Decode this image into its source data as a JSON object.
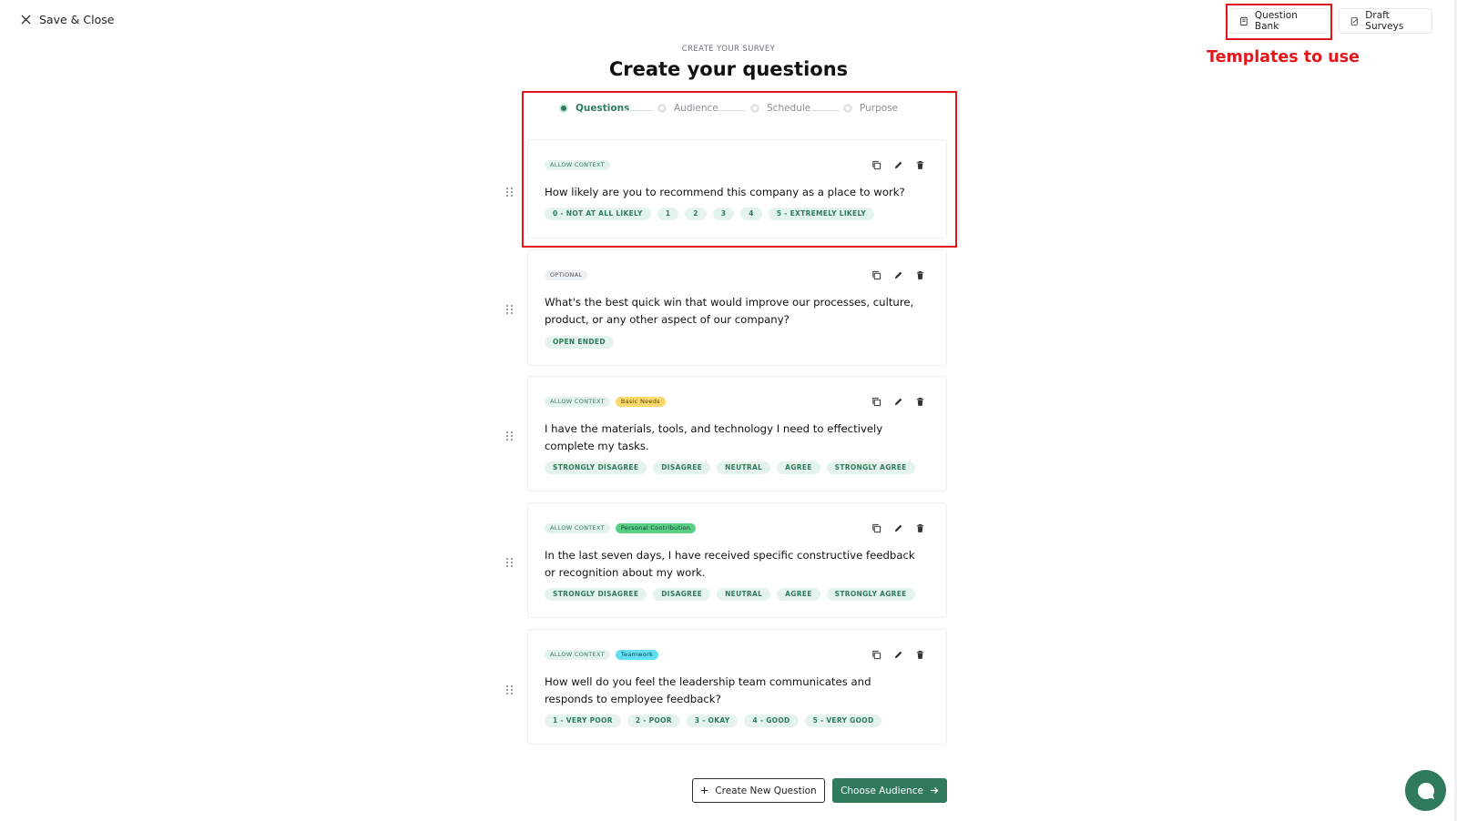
{
  "header": {
    "save_close_label": "Save & Close",
    "question_bank_label": "Question Bank",
    "draft_surveys_label": "Draft Surveys"
  },
  "annotation": {
    "text": "Templates to use",
    "color": "#e3161b"
  },
  "page": {
    "eyebrow": "CREATE YOUR SURVEY",
    "title": "Create your questions"
  },
  "stepper": {
    "steps": [
      {
        "label": "Questions",
        "active": true
      },
      {
        "label": "Audience",
        "active": false
      },
      {
        "label": "Schedule",
        "active": false
      },
      {
        "label": "Purpose",
        "active": false
      }
    ]
  },
  "questions": [
    {
      "tags": [
        "ALLOW CONTEXT"
      ],
      "category": "",
      "text": "How likely are you to recommend this company as a place to work?",
      "options": [
        "0 - NOT AT ALL LIKELY",
        "1",
        "2",
        "3",
        "4",
        "5 - EXTREMELY LIKELY"
      ]
    },
    {
      "tags": [
        "OPTIONAL"
      ],
      "category": "",
      "text": "What's the best quick win that would improve our processes, culture, product, or any other aspect of our company?",
      "options": [
        "OPEN ENDED"
      ]
    },
    {
      "tags": [
        "ALLOW CONTEXT"
      ],
      "category": "Basic Needs",
      "text": "I have the materials, tools, and technology I need to effectively complete my tasks.",
      "options": [
        "STRONGLY DISAGREE",
        "DISAGREE",
        "NEUTRAL",
        "AGREE",
        "STRONGLY AGREE"
      ]
    },
    {
      "tags": [
        "ALLOW CONTEXT"
      ],
      "category": "Personal Contribution",
      "text": "In the last seven days, I have received specific constructive feedback or recognition about my work.",
      "options": [
        "STRONGLY DISAGREE",
        "DISAGREE",
        "NEUTRAL",
        "AGREE",
        "STRONGLY AGREE"
      ]
    },
    {
      "tags": [
        "ALLOW CONTEXT"
      ],
      "category": "Teamwork",
      "text": "How well do you feel the leadership team communicates and responds to employee feedback?",
      "options": [
        "1 - VERY POOR",
        "2 - POOR",
        "3 - OKAY",
        "4 - GOOD",
        "5 - VERY GOOD"
      ]
    }
  ],
  "footer": {
    "create_new_label": "Create New Question",
    "choose_audience_label": "Choose Audience"
  },
  "colors": {
    "primary": "#2f7a5b",
    "basic_needs": "#f9d96b",
    "personal_contribution": "#58cf85",
    "teamwork": "#62e0f2"
  },
  "icons": [
    "close-icon",
    "book-icon",
    "draft-icon",
    "copy-icon",
    "edit-icon",
    "trash-icon",
    "drag-handle-icon",
    "plus-icon",
    "arrow-right-icon",
    "chat-icon"
  ]
}
